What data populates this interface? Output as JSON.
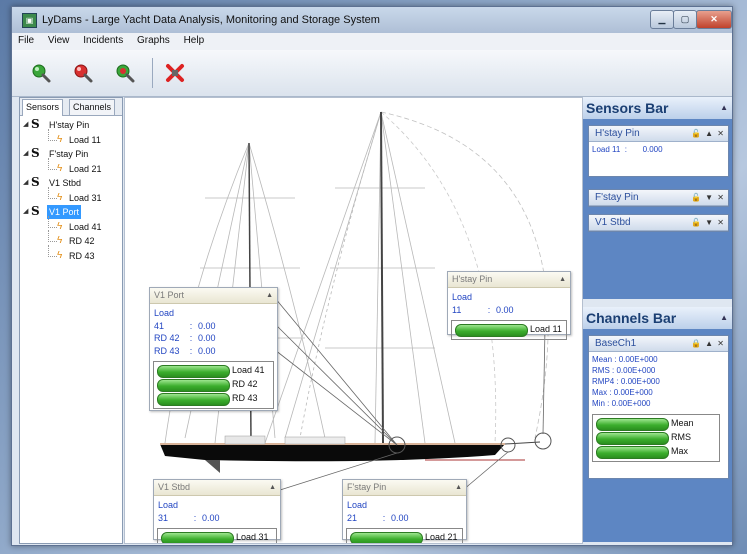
{
  "window": {
    "title": "LyDams - Large Yacht Data Analysis, Monitoring and Storage System"
  },
  "menu": [
    "File",
    "View",
    "Incidents",
    "Graphs",
    "Help"
  ],
  "colors": {
    "gauge_green": "#3cae2d",
    "value_blue": "#2346c2",
    "dock_blue": "#5d86c3",
    "hull": "#0a0a0a"
  },
  "tabs": {
    "sensors": "Sensors",
    "channels": "Channels"
  },
  "tree": {
    "sensors": [
      {
        "name": "H'stay Pin",
        "loads": [
          "Load 11"
        ]
      },
      {
        "name": "F'stay Pin",
        "loads": [
          "Load 21"
        ]
      },
      {
        "name": "V1 Stbd",
        "loads": [
          "Load 31"
        ]
      },
      {
        "name": "V1 Port",
        "loads": [
          "Load 41",
          "RD 42",
          "RD 43"
        ]
      }
    ]
  },
  "cards": {
    "v1port": {
      "title": "V1 Port",
      "rows": [
        [
          "Load 41",
          "0.00"
        ],
        [
          "RD 42",
          "0.00"
        ],
        [
          "RD 43",
          "0.00"
        ]
      ],
      "gauges": [
        "Load 41",
        "RD 42",
        "RD 43"
      ]
    },
    "hstay": {
      "title": "H'stay Pin",
      "rows": [
        [
          "Load 11",
          "0.00"
        ]
      ],
      "gauges": [
        "Load 11"
      ]
    },
    "v1stbd": {
      "title": "V1 Stbd",
      "rows": [
        [
          "Load 31",
          "0.00"
        ]
      ],
      "gauges": [
        "Load 31"
      ]
    },
    "fstay": {
      "title": "F'stay Pin",
      "rows": [
        [
          "Load 21",
          "0.00"
        ]
      ],
      "gauges": [
        "Load 21"
      ]
    }
  },
  "sensors_bar": {
    "title": "Sensors Bar",
    "items": [
      {
        "title": "H'stay Pin",
        "value_label": "Load 11",
        "value": "0.000"
      },
      {
        "title": "F'stay Pin"
      },
      {
        "title": "V1 Stbd"
      }
    ]
  },
  "channels_bar": {
    "title": "Channels Bar",
    "item": {
      "title": "BaseCh1",
      "stats": [
        [
          "Mean",
          "0.00E+000"
        ],
        [
          "RMS",
          "0.00E+000"
        ],
        [
          "RMP4",
          "0.00E+000"
        ],
        [
          "Max",
          "0.00E+000"
        ],
        [
          "Min",
          "0.00E+000"
        ]
      ],
      "gauges": [
        "Mean",
        "RMS",
        "Max"
      ]
    }
  }
}
